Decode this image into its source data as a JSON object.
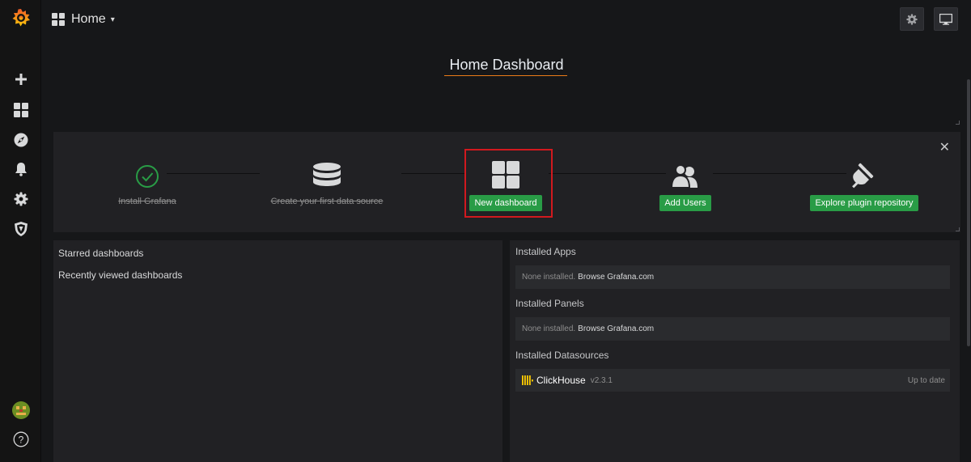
{
  "colors": {
    "brand_orange": "#eb7b18",
    "success_green": "#299c46",
    "highlight_red": "#d1191e"
  },
  "sidemenu": {
    "logo_icon": "grafana-logo-icon",
    "items": [
      {
        "icon": "plus-icon"
      },
      {
        "icon": "dashboards-grid-icon"
      },
      {
        "icon": "explore-compass-icon"
      },
      {
        "icon": "alerting-bell-icon"
      },
      {
        "icon": "configuration-gear-icon"
      },
      {
        "icon": "server-admin-shield-icon"
      }
    ],
    "bottom": [
      {
        "icon": "user-avatar-icon"
      },
      {
        "icon": "help-icon",
        "glyph": "?"
      }
    ]
  },
  "navbar": {
    "title": "Home",
    "caret": "▾",
    "settings_icon": "gear-icon",
    "tv_icon": "monitor-icon"
  },
  "home": {
    "title": "Home Dashboard"
  },
  "getting_started": {
    "close_glyph": "✕",
    "steps": [
      {
        "label": "Install Grafana",
        "done": true,
        "icon": "check-circle-icon"
      },
      {
        "label": "Create your first data source",
        "done": true,
        "icon": "database-icon"
      },
      {
        "label": "New dashboard",
        "done": false,
        "icon": "dashboard-grid-icon"
      },
      {
        "label": "Add Users",
        "done": false,
        "icon": "users-icon"
      },
      {
        "label": "Explore plugin repository",
        "done": false,
        "icon": "plug-icon"
      }
    ]
  },
  "left_panel": {
    "starred": "Starred dashboards",
    "recent": "Recently viewed dashboards"
  },
  "right_panel": {
    "apps_heading": "Installed Apps",
    "apps_none": "None installed.",
    "apps_link": "Browse Grafana.com",
    "panels_heading": "Installed Panels",
    "panels_none": "None installed.",
    "panels_link": "Browse Grafana.com",
    "datasources_heading": "Installed Datasources",
    "datasource": {
      "name": "ClickHouse",
      "version": "v2.3.1",
      "status": "Up to date",
      "icon": "clickhouse-logo-icon"
    }
  }
}
